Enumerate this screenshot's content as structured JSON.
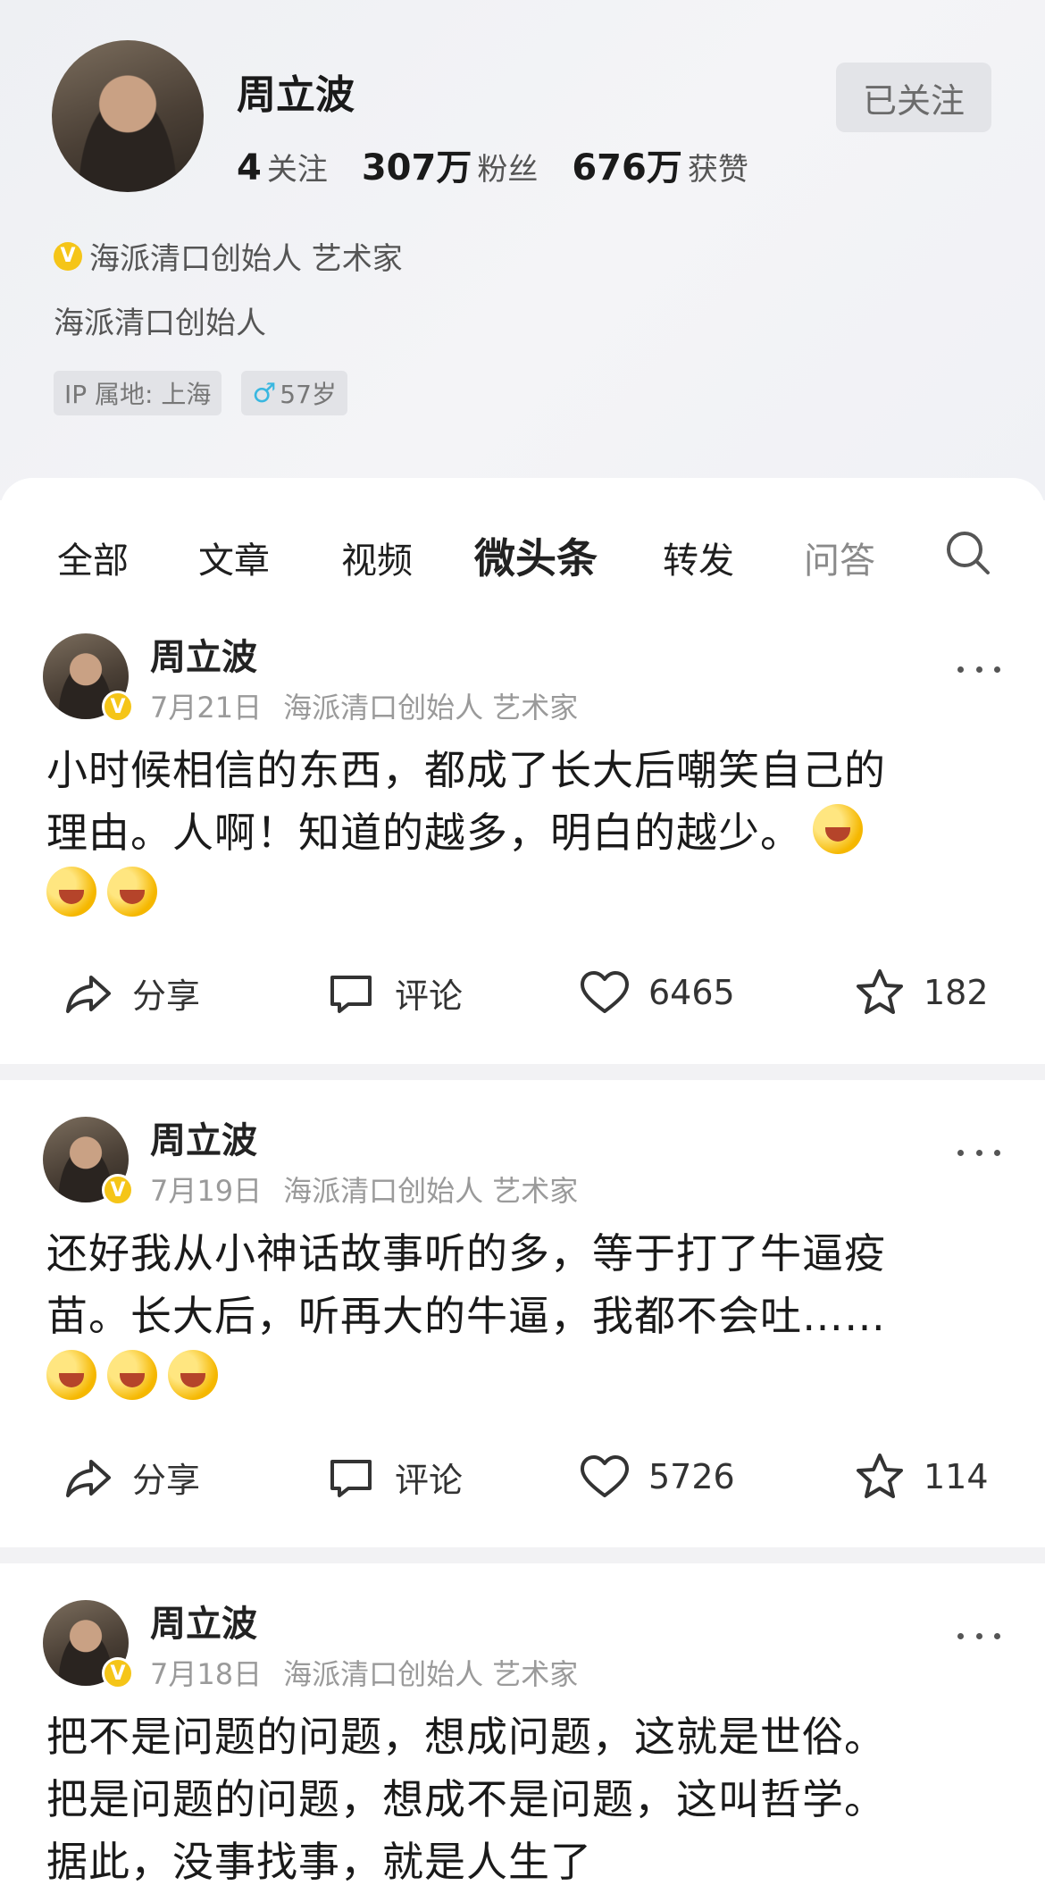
{
  "profile": {
    "name": "周立波",
    "follow_button": "已关注",
    "stats": [
      {
        "num": "4",
        "label": "关注"
      },
      {
        "num": "307万",
        "label": "粉丝"
      },
      {
        "num": "676万",
        "label": "获赞"
      }
    ],
    "verified_badge": "V",
    "certification": "海派清口创始人 艺术家",
    "bio": "海派清口创始人",
    "ip_tag": "IP 属地: 上海",
    "age_tag": "57岁",
    "gender_icon": "male-icon"
  },
  "tabs": [
    "全部",
    "文章",
    "视频",
    "微头条",
    "转发",
    "问答"
  ],
  "active_tab": "微头条",
  "posts": [
    {
      "author": "周立波",
      "date": "7月21日",
      "cert": "海派清口创始人 艺术家",
      "lines": [
        "小时候相信的东西，都成了长大后嘲笑自己的",
        "理由。人啊！知道的越多，明白的越少。"
      ],
      "emoji_count_line2": 1,
      "emoji_count_line3": 2,
      "share": "分享",
      "comment": "评论",
      "likes": "6465",
      "favorites": "182"
    },
    {
      "author": "周立波",
      "date": "7月19日",
      "cert": "海派清口创始人 艺术家",
      "lines": [
        "还好我从小神话故事听的多，等于打了牛逼疫",
        "苗。长大后，听再大的牛逼，我都不会吐……"
      ],
      "emoji_count_line2": 0,
      "emoji_count_line3": 3,
      "share": "分享",
      "comment": "评论",
      "likes": "5726",
      "favorites": "114"
    },
    {
      "author": "周立波",
      "date": "7月18日",
      "cert": "海派清口创始人 艺术家",
      "lines": [
        "把不是问题的问题，想成问题，这就是世俗。",
        "把是问题的问题，想成不是问题，这叫哲学。",
        "据此，没事找事，就是人生了"
      ]
    }
  ],
  "colors": {
    "verified": "#f5c518",
    "header_bg": "#eef0f3",
    "divider": "#f2f2f4",
    "gender": "#39b7e0"
  }
}
